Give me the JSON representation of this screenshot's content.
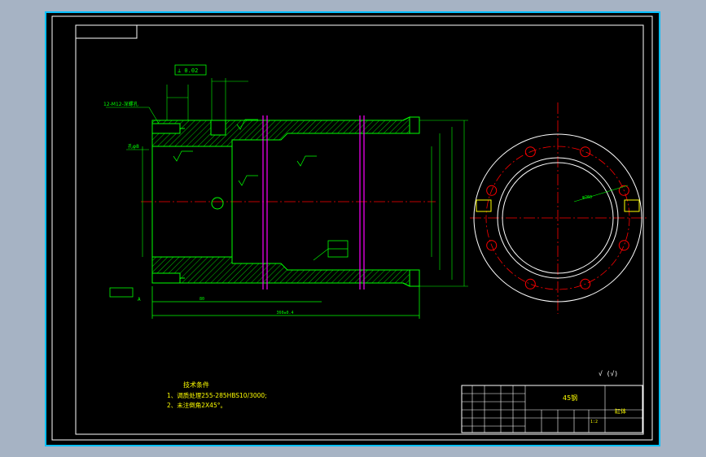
{
  "drawing": {
    "tech_req_title": "技术条件",
    "tech_req_1": "1、调质处理255-285HBS10/3000;",
    "tech_req_2": "2、未注倒角2X45°。",
    "leader_thread": "12-M12-深螺孔",
    "leader_bore": "孔φ8",
    "datum_A": "A",
    "datum_box": "⊥ 0.02",
    "dim_overall": "360±0.4",
    "dim_left": "80",
    "material": "45钢",
    "part_name": "缸体",
    "scale": "1:2",
    "surface_note": "√ (√)",
    "flange_circle_dim": "φ260"
  },
  "colors": {
    "background": "#000000",
    "frame": "#ffffff",
    "outline": "#00ff00",
    "center": "#ff0000",
    "hatch": "#00ff00",
    "magenta": "#ff00ff",
    "yellow": "#ffff00",
    "border": "#00c0ff"
  }
}
